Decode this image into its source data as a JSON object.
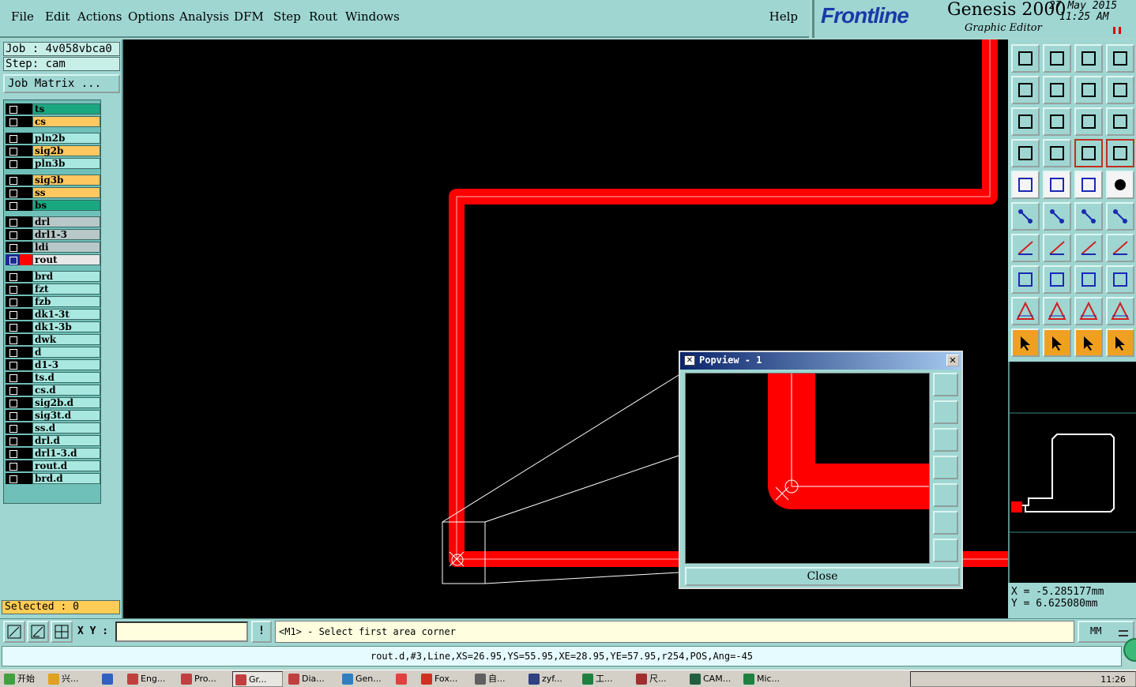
{
  "menu": {
    "items": [
      "File",
      "Edit",
      "Actions",
      "Options",
      "Analysis",
      "DFM",
      "Step",
      "Rout",
      "Windows"
    ],
    "help": "Help"
  },
  "brand": {
    "logo": "Frontline",
    "product": "Genesis 2000",
    "subtitle": "Graphic Editor",
    "date": "27 May 2015",
    "time": "11:25 AM"
  },
  "job": {
    "job_line": "Job : 4v058vbca0",
    "step_line": "Step: cam",
    "matrix_button": "Job Matrix ..."
  },
  "layers": [
    {
      "name": "ts",
      "color": "#1aa880",
      "visible": false
    },
    {
      "name": "cs",
      "color": "#ffc860",
      "visible": false
    },
    {
      "name": "pln2b",
      "color": "#a8e8e0",
      "visible": false
    },
    {
      "name": "sig2b",
      "color": "#ffc860",
      "visible": false
    },
    {
      "name": "pln3b",
      "color": "#a8e8e0",
      "visible": false
    },
    {
      "name": "sig3b",
      "color": "#ffc860",
      "visible": false
    },
    {
      "name": "ss",
      "color": "#ffc860",
      "visible": false
    },
    {
      "name": "bs",
      "color": "#1aa880",
      "visible": false
    },
    {
      "name": "drl",
      "color": "#b8c8c8",
      "visible": false
    },
    {
      "name": "drl1-3",
      "color": "#b8c8c8",
      "visible": false
    },
    {
      "name": "ldi",
      "color": "#b8c8c8",
      "visible": false
    },
    {
      "name": "rout",
      "color": "#e8e8e8",
      "visible": true,
      "swatch": "#ff0000"
    },
    {
      "name": "brd",
      "color": "#a8e8e0",
      "visible": false
    },
    {
      "name": "fzt",
      "color": "#a8e8e0",
      "visible": false
    },
    {
      "name": "fzb",
      "color": "#a8e8e0",
      "visible": false
    },
    {
      "name": "dk1-3t",
      "color": "#a8e8e0",
      "visible": false
    },
    {
      "name": "dk1-3b",
      "color": "#a8e8e0",
      "visible": false
    },
    {
      "name": "dwk",
      "color": "#a8e8e0",
      "visible": false
    },
    {
      "name": "d",
      "color": "#a8e8e0",
      "visible": false
    },
    {
      "name": "d1-3",
      "color": "#a8e8e0",
      "visible": false
    },
    {
      "name": "ts.d",
      "color": "#a8e8e0",
      "visible": false
    },
    {
      "name": "cs.d",
      "color": "#a8e8e0",
      "visible": false
    },
    {
      "name": "sig2b.d",
      "color": "#a8e8e0",
      "visible": false
    },
    {
      "name": "sig3t.d",
      "color": "#a8e8e0",
      "visible": false
    },
    {
      "name": "ss.d",
      "color": "#a8e8e0",
      "visible": false
    },
    {
      "name": "drl.d",
      "color": "#a8e8e0",
      "visible": false
    },
    {
      "name": "drl1-3.d",
      "color": "#a8e8e0",
      "visible": false
    },
    {
      "name": "rout.d",
      "color": "#a8e8e0",
      "visible": false
    },
    {
      "name": "brd.d",
      "color": "#a8e8e0",
      "visible": false
    }
  ],
  "selected": "Selected : 0",
  "popview": {
    "title": "Popview - 1",
    "close": "Close"
  },
  "coords": {
    "x": "X = -5.285177mm",
    "y": "Y = 6.625080mm"
  },
  "command": {
    "xy_label": "X Y :",
    "xy_value": "",
    "bang": "!",
    "prompt": "<M1> - Select first area corner",
    "units": "MM"
  },
  "status": "rout.d,#3,Line,XS=26.95,YS=55.95,XE=28.95,YE=57.95,r254,POS,Ang=-45",
  "taskbar": {
    "start": "开始",
    "tasks": [
      {
        "label": "兴...",
        "color": "#e0a020"
      },
      {
        "label": "",
        "color": "#3060c0"
      },
      {
        "label": "Eng...",
        "color": "#c04040"
      },
      {
        "label": "Pro...",
        "color": "#c04040"
      },
      {
        "label": "Gr...",
        "color": "#c04040",
        "active": true
      },
      {
        "label": "Dia...",
        "color": "#c04040"
      },
      {
        "label": "Gen...",
        "color": "#3080c0"
      },
      {
        "label": "",
        "color": "#e04040"
      },
      {
        "label": "Fox...",
        "color": "#d03020"
      },
      {
        "label": "自...",
        "color": "#606060"
      },
      {
        "label": "zyf...",
        "color": "#304080"
      },
      {
        "label": "工...",
        "color": "#208040"
      },
      {
        "label": "尺...",
        "color": "#a03030"
      },
      {
        "label": "CAM...",
        "color": "#206040"
      },
      {
        "label": "Mic...",
        "color": "#208040"
      }
    ],
    "clock": "11:26"
  }
}
